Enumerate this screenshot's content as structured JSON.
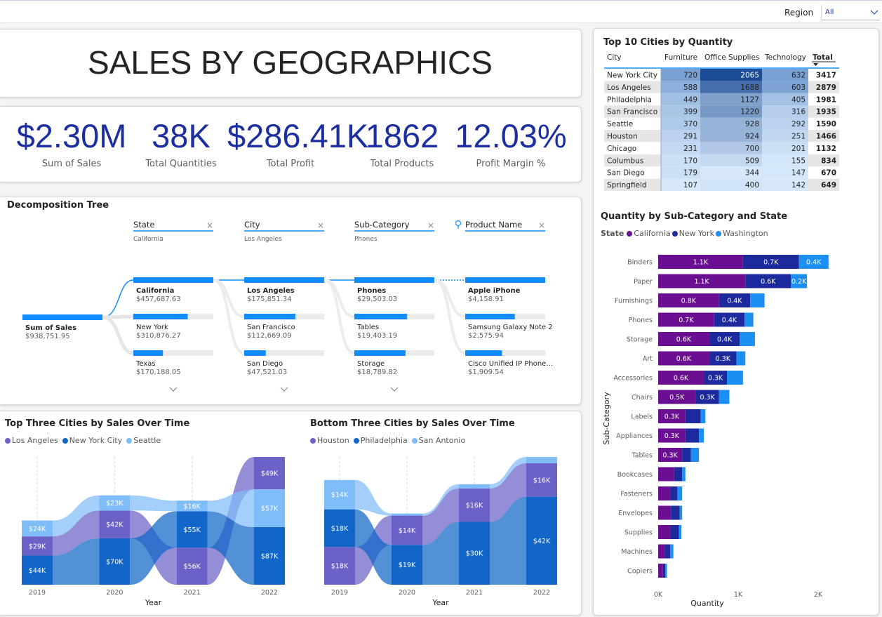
{
  "filter": {
    "label": "Region",
    "value": "All"
  },
  "title": "SALES BY GEOGRAPHICS",
  "kpis": [
    {
      "value": "$2.30M",
      "label": "Sum of Sales"
    },
    {
      "value": "38K",
      "label": "Total Quantities"
    },
    {
      "value": "$286.41K",
      "label": "Total Profit"
    },
    {
      "value": "1862",
      "label": "Total Products"
    },
    {
      "value": "12.03%",
      "label": "Profit Margin %"
    }
  ],
  "decomp": {
    "title": "Decomposition Tree",
    "root": {
      "label": "Sum of Sales",
      "value": "$938,751.95"
    },
    "levels": [
      {
        "header": "State",
        "sub": "California",
        "items": [
          {
            "name": "California",
            "value": "$457,687.63",
            "share": 1.0,
            "selected": true
          },
          {
            "name": "New York",
            "value": "$310,876.27",
            "share": 0.68
          },
          {
            "name": "Texas",
            "value": "$170,188.05",
            "share": 0.37
          }
        ]
      },
      {
        "header": "City",
        "sub": "Los Angeles",
        "items": [
          {
            "name": "Los Angeles",
            "value": "$175,851.34",
            "share": 1.0,
            "selected": true
          },
          {
            "name": "San Francisco",
            "value": "$112,669.09",
            "share": 0.64
          },
          {
            "name": "San Diego",
            "value": "$47,521.03",
            "share": 0.27
          }
        ]
      },
      {
        "header": "Sub-Category",
        "sub": "Phones",
        "items": [
          {
            "name": "Phones",
            "value": "$29,503.03",
            "share": 1.0,
            "selected": true
          },
          {
            "name": "Tables",
            "value": "$19,403.19",
            "share": 0.66
          },
          {
            "name": "Storage",
            "value": "$18,789.82",
            "share": 0.64
          }
        ]
      },
      {
        "header": "Product Name",
        "sub": "",
        "items": [
          {
            "name": "Apple iPhone",
            "value": "$4,158.91",
            "share": 1.0,
            "selected": true
          },
          {
            "name": "Samsung Galaxy Note 2",
            "value": "$2,575.94",
            "share": 0.62
          },
          {
            "name": "Cisco Unified IP Phone…",
            "value": "$1,909.54",
            "share": 0.46
          }
        ]
      }
    ]
  },
  "cities_table": {
    "title": "Top 10 Cities by Quantity",
    "columns": [
      "City",
      "Furniture",
      "Office Supplies",
      "Technology",
      "Total"
    ],
    "rows": [
      [
        "New York City",
        "720",
        "2065",
        "632",
        "3417"
      ],
      [
        "Los Angeles",
        "588",
        "1688",
        "603",
        "2879"
      ],
      [
        "Philadelphia",
        "449",
        "1127",
        "405",
        "1981"
      ],
      [
        "San Francisco",
        "399",
        "1220",
        "316",
        "1935"
      ],
      [
        "Seattle",
        "370",
        "928",
        "292",
        "1590"
      ],
      [
        "Houston",
        "291",
        "924",
        "251",
        "1466"
      ],
      [
        "Chicago",
        "231",
        "700",
        "201",
        "1132"
      ],
      [
        "Columbus",
        "170",
        "509",
        "155",
        "834"
      ],
      [
        "San Diego",
        "179",
        "344",
        "147",
        "670"
      ],
      [
        "Springfield",
        "107",
        "400",
        "142",
        "649"
      ]
    ]
  },
  "chart_data": [
    {
      "type": "area",
      "title": "Top Three Cities by Sales Over Time",
      "xlabel": "Year",
      "x": [
        "2019",
        "2020",
        "2021",
        "2022"
      ],
      "series": [
        {
          "name": "Los Angeles",
          "color": "#6b62c8",
          "values": [
            29,
            42,
            56,
            49
          ],
          "labels": [
            "$29K",
            "$42K",
            "$56K",
            "$49K"
          ]
        },
        {
          "name": "New York City",
          "color": "#1166c7",
          "values": [
            44,
            70,
            55,
            87
          ],
          "labels": [
            "$44K",
            "$70K",
            "$55K",
            "$87K"
          ]
        },
        {
          "name": "Seattle",
          "color": "#7fbdf8",
          "values": [
            24,
            23,
            16,
            57
          ],
          "labels": [
            "$24K",
            "$23K",
            "$16K",
            "$57K"
          ]
        }
      ]
    },
    {
      "type": "area",
      "title": "Bottom Three Cities by Sales Over Time",
      "xlabel": "Year",
      "x": [
        "2019",
        "2020",
        "2021",
        "2022"
      ],
      "series": [
        {
          "name": "Houston",
          "color": "#6b62c8",
          "values": [
            18,
            14,
            16,
            16
          ],
          "labels": [
            "$18K",
            "$14K",
            "$16K",
            "$16K"
          ]
        },
        {
          "name": "Philadelphia",
          "color": "#1166c7",
          "values": [
            18,
            19,
            30,
            42
          ],
          "labels": [
            "$18K",
            "$19K",
            "$30K",
            "$42K"
          ]
        },
        {
          "name": "San Antonio",
          "color": "#7fbdf8",
          "values": [
            14,
            1,
            2,
            3
          ],
          "labels": [
            "$14K",
            "",
            "",
            ""
          ]
        }
      ]
    },
    {
      "type": "bar",
      "title": "Quantity by Sub-Category and State",
      "legend_title": "State",
      "xlabel": "Quantity",
      "ylabel": "Sub-Category",
      "xticks": [
        "0K",
        "1K",
        "2K"
      ],
      "xlim": [
        0,
        2000
      ],
      "categories": [
        "Binders",
        "Paper",
        "Furnishings",
        "Phones",
        "Storage",
        "Art",
        "Accessories",
        "Chairs",
        "Labels",
        "Appliances",
        "Tables",
        "Bookcases",
        "Fasteners",
        "Envelopes",
        "Supplies",
        "Machines",
        "Copiers"
      ],
      "series": [
        {
          "name": "California",
          "color": "#6a0f91",
          "values": [
            1060,
            1090,
            760,
            700,
            640,
            640,
            570,
            470,
            340,
            340,
            300,
            200,
            150,
            160,
            150,
            80,
            60
          ],
          "labels": [
            "1.1K",
            "1.1K",
            "0.8K",
            "0.7K",
            "0.6K",
            "0.6K",
            "0.6K",
            "0.5K",
            "0.3K",
            "0.3K",
            "0.3K",
            "",
            "",
            "",
            "",
            "",
            ""
          ]
        },
        {
          "name": "New York",
          "color": "#1d2a9e",
          "values": [
            700,
            570,
            390,
            380,
            380,
            340,
            290,
            290,
            190,
            170,
            110,
            100,
            90,
            110,
            110,
            70,
            30
          ],
          "labels": [
            "0.7K",
            "0.6K",
            "0.4K",
            "0.4K",
            "0.4K",
            "0.3K",
            "0.3K",
            "0.3K",
            "",
            "",
            "",
            "",
            "",
            "",
            "",
            "",
            ""
          ]
        },
        {
          "name": "Washington",
          "color": "#1b8ff2",
          "values": [
            370,
            200,
            180,
            110,
            190,
            110,
            200,
            130,
            60,
            60,
            100,
            40,
            60,
            30,
            30,
            40,
            20
          ],
          "labels": [
            "0.4K",
            "0.2K",
            "",
            "",
            "",
            "",
            "",
            "",
            "",
            "",
            "",
            "",
            "",
            "",
            "",
            "",
            ""
          ]
        }
      ]
    }
  ]
}
